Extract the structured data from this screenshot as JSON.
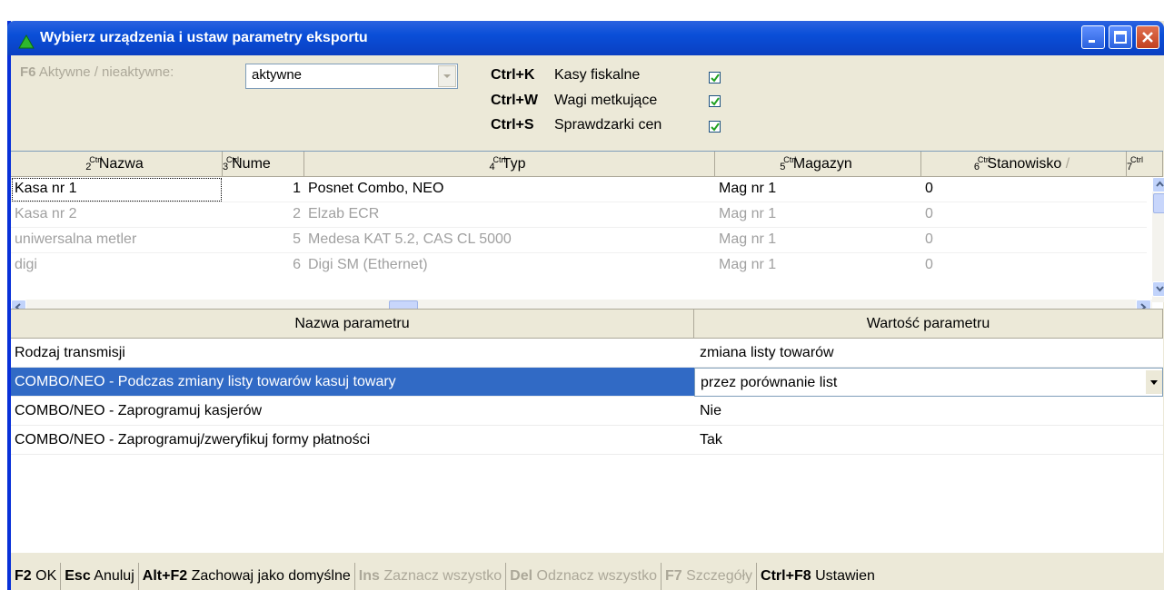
{
  "window": {
    "title": "Wybierz urządzenia i ustaw parametry eksportu"
  },
  "filter": {
    "shortcut": "F6",
    "label": "Aktywne / nieaktywne:",
    "value": "aktywne"
  },
  "device_types": [
    {
      "shortcut": "Ctrl+K",
      "label": "Kasy fiskalne",
      "checked": true
    },
    {
      "shortcut": "Ctrl+W",
      "label": "Wagi metkujące",
      "checked": true
    },
    {
      "shortcut": "Ctrl+S",
      "label": "Sprawdzarki cen",
      "checked": true
    }
  ],
  "devices_grid": {
    "columns": [
      {
        "ctrl": "Ctrl",
        "num": "2",
        "label": "Nazwa"
      },
      {
        "ctrl": "Ctrl",
        "num": "3",
        "label": "Nume"
      },
      {
        "ctrl": "Ctrl",
        "num": "4",
        "label": "Typ"
      },
      {
        "ctrl": "Ctrl",
        "num": "5",
        "label": "Magazyn"
      },
      {
        "ctrl": "Ctrl",
        "num": "6",
        "label": "Stanowisko",
        "sort": "/"
      },
      {
        "ctrl": "Ctrl",
        "num": "7",
        "label": ""
      }
    ],
    "rows": [
      {
        "name": "Kasa nr 1",
        "number": "1",
        "type": "Posnet Combo, NEO",
        "warehouse": "Mag nr 1",
        "station": "0",
        "active": true
      },
      {
        "name": "Kasa nr 2",
        "number": "2",
        "type": "Elzab ECR",
        "warehouse": "Mag nr 1",
        "station": "0",
        "active": false
      },
      {
        "name": "uniwersalna metler",
        "number": "5",
        "type": "Medesa KAT 5.2, CAS CL 5000",
        "warehouse": "Mag nr 1",
        "station": "0",
        "active": false
      },
      {
        "name": "digi",
        "number": "6",
        "type": "Digi SM (Ethernet)",
        "warehouse": "Mag nr 1",
        "station": "0",
        "active": false
      }
    ]
  },
  "params_grid": {
    "col_name": "Nazwa parametru",
    "col_value": "Wartość parametru",
    "rows": [
      {
        "name": "Rodzaj transmisji",
        "value": "zmiana listy towarów"
      },
      {
        "name": "COMBO/NEO - Podczas zmiany listy towarów kasuj towary",
        "value": "przez porównanie list",
        "selected": true
      },
      {
        "name": "COMBO/NEO - Zaprogramuj kasjerów",
        "value": "Nie"
      },
      {
        "name": "COMBO/NEO - Zaprogramuj/zweryfikuj formy płatności",
        "value": "Tak"
      }
    ]
  },
  "statusbar": [
    {
      "key": "F2",
      "label": "OK",
      "enabled": true
    },
    {
      "key": "Esc",
      "label": "Anuluj",
      "enabled": true
    },
    {
      "key": "Alt+F2",
      "label": "Zachowaj jako domyślne",
      "enabled": true
    },
    {
      "key": "Ins",
      "label": "Zaznacz wszystko",
      "enabled": false
    },
    {
      "key": "Del",
      "label": "Odznacz wszystko",
      "enabled": false
    },
    {
      "key": "F7",
      "label": "Szczegóły",
      "enabled": false
    },
    {
      "key": "Ctrl+F8",
      "label": "Ustawien",
      "enabled": true
    }
  ]
}
